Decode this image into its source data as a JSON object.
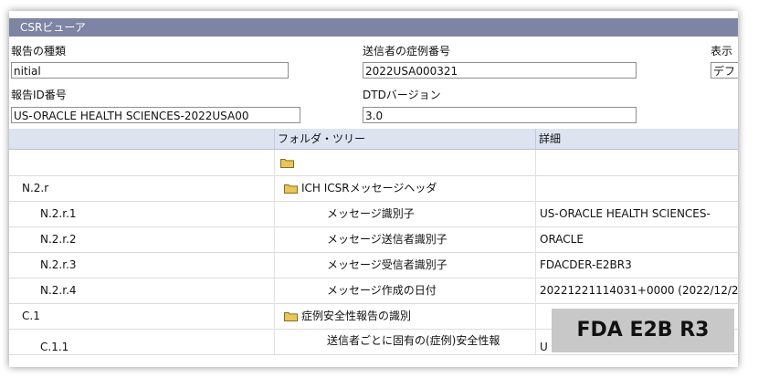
{
  "window": {
    "title": "CSRビューア"
  },
  "form": {
    "report_type_label": "報告の種類",
    "report_type_value": "nitial",
    "sender_case_label": "送信者の症例番号",
    "sender_case_value": "2022USA000321",
    "display_label": "表示",
    "display_value": "デフ",
    "report_id_label": "報告ID番号",
    "report_id_value": "US-ORACLE HEALTH SCIENCES-2022USA00",
    "dtd_label": "DTDバージョン",
    "dtd_value": "3.0"
  },
  "grid": {
    "columns": [
      "",
      "フォルダ・ツリー",
      "詳細"
    ],
    "rows": [
      {
        "id": "",
        "tree": "",
        "folder": true,
        "detail": ""
      },
      {
        "id": "N.2.r",
        "tree": "ICH ICSRメッセージヘッダ",
        "folder": true,
        "detail": ""
      },
      {
        "id": "N.2.r.1",
        "tree": "メッセージ識別子",
        "folder": false,
        "detail": "US-ORACLE HEALTH SCIENCES-"
      },
      {
        "id": "N.2.r.2",
        "tree": "メッセージ送信者識別子",
        "folder": false,
        "detail": "ORACLE"
      },
      {
        "id": "N.2.r.3",
        "tree": "メッセージ受信者識別子",
        "folder": false,
        "detail": "FDACDER-E2BR3"
      },
      {
        "id": "N.2.r.4",
        "tree": "メッセージ作成の日付",
        "folder": false,
        "detail": "20221221114031+0000 (2022/12/2"
      },
      {
        "id": "C.1",
        "tree": "症例安全性報告の識別",
        "folder": true,
        "detail": ""
      },
      {
        "id": "C.1.1",
        "tree": "送信者ごとに固有の(症例)安全性報",
        "folder": false,
        "detail": "U"
      }
    ]
  },
  "badge": {
    "text": "FDA E2B R3"
  },
  "colors": {
    "titlebar": "#7e84a3",
    "header": "#dde3f1",
    "folder": "#e8c65a",
    "badge": "#c8c8c8"
  }
}
